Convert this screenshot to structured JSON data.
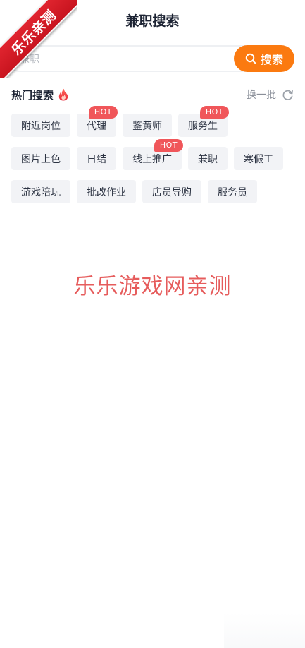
{
  "watermark": {
    "corner_text": "乐乐亲测",
    "center_text": "乐乐游戏网亲测"
  },
  "header": {
    "title": "兼职搜索"
  },
  "search": {
    "placeholder": "兼职",
    "value": "",
    "button_label": "搜索",
    "button_icon": "search-icon",
    "accent_color": "#fb7a10"
  },
  "hot": {
    "title": "热门搜索",
    "title_icon": "fire-icon",
    "refresh_label": "换一批",
    "refresh_icon": "refresh-icon",
    "badge_label": "HOT",
    "badge_color": "#f0565a",
    "rows": [
      [
        {
          "label": "附近岗位",
          "hot": false
        },
        {
          "label": "代理",
          "hot": true
        },
        {
          "label": "鉴黄师",
          "hot": false
        },
        {
          "label": "服务生",
          "hot": true
        }
      ],
      [
        {
          "label": "图片上色",
          "hot": false
        },
        {
          "label": "日结",
          "hot": false
        },
        {
          "label": "线上推广",
          "hot": true
        },
        {
          "label": "兼职",
          "hot": false
        },
        {
          "label": "寒假工",
          "hot": false
        }
      ],
      [
        {
          "label": "游戏陪玩",
          "hot": false
        },
        {
          "label": "批改作业",
          "hot": false
        },
        {
          "label": "店员导购",
          "hot": false
        },
        {
          "label": "服务员",
          "hot": false
        }
      ]
    ]
  }
}
